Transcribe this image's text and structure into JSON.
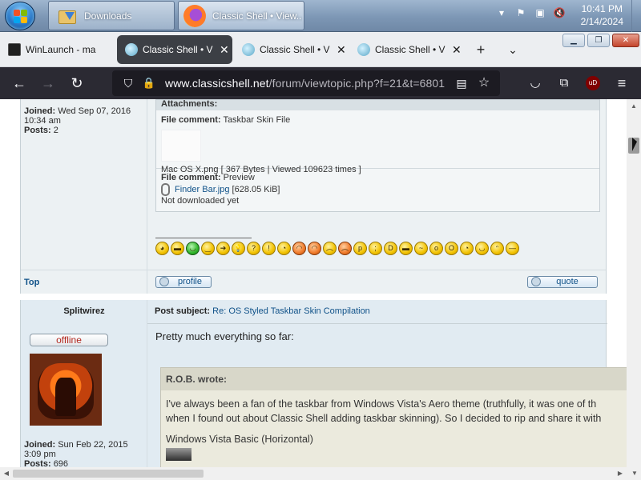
{
  "taskbar": {
    "tasks": [
      {
        "label": "Downloads",
        "icon": "folder-download-icon"
      },
      {
        "label": "Classic Shell • View...",
        "icon": "firefox-icon"
      }
    ],
    "clock_time": "10:41 PM",
    "clock_date": "2/14/2024"
  },
  "browser": {
    "tabs": [
      {
        "title": "WinLaunch - ma",
        "icon": "winlaunch-icon",
        "active": false
      },
      {
        "title": "Classic Shell • Vi",
        "icon": "classic-shell-icon",
        "active": true
      },
      {
        "title": "Classic Shell • Vi",
        "icon": "classic-shell-icon",
        "active": false
      },
      {
        "title": "Classic Shell • Vi",
        "icon": "classic-shell-icon",
        "active": false
      }
    ],
    "url_host": "www.classicshell.net",
    "url_path": "/forum/viewtopic.php?f=21&t=6801"
  },
  "post1": {
    "joined_label": "Joined:",
    "joined_value": "Wed Sep 07, 2016",
    "joined_time": "10:34 am",
    "posts_label": "Posts:",
    "posts_value": "2",
    "attachments_title": "Attachments:",
    "file_comment_label": "File comment:",
    "attachment1_comment": "Taskbar Skin File",
    "attachment1_info": "Mac OS X.png [ 367 Bytes | Viewed 109623 times ]",
    "attachment2_comment": "Preview",
    "attachment2_name": "Finder Bar.jpg",
    "attachment2_size": "[628.05 KiB]",
    "attachment2_status": "Not downloaded yet",
    "top_link": "Top",
    "profile_button": "profile",
    "quote_button": "quote"
  },
  "post2": {
    "author": "Splitwirez",
    "status": "offline",
    "subject_label": "Post subject:",
    "subject": "Re: OS Styled Taskbar Skin Compilation",
    "body": "Pretty much everything so far:",
    "quote_author": "R.O.B. wrote:",
    "quote_line1": "I've always been a fan of the taskbar from Windows Vista's Aero theme (truthfully, it was one of th",
    "quote_line2": "when I found out about Classic Shell adding taskbar skinning). So I decided to rip and share it with",
    "quote_line3": "Windows Vista Basic (Horizontal)",
    "joined_label": "Joined:",
    "joined_value": "Sun Feb 22, 2015",
    "joined_time": "3:09 pm",
    "posts_label": "Posts:",
    "posts_value": "696"
  },
  "colors": {
    "link": "#105289",
    "offline": "#b3281f",
    "nav_bg": "#2b2a33"
  }
}
